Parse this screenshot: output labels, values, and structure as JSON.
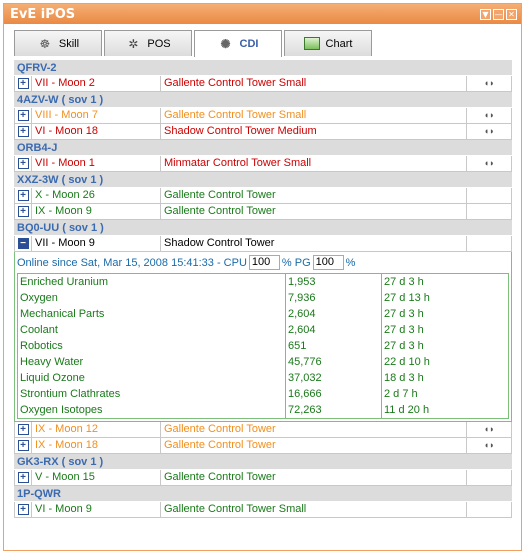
{
  "window": {
    "title": "EvE iPOS",
    "buttons": [
      "▼",
      "—",
      "✕"
    ]
  },
  "tabs": [
    {
      "label": "Skill",
      "icon": "skill-icon",
      "active": false
    },
    {
      "label": "POS",
      "icon": "pos-icon",
      "active": false
    },
    {
      "label": "CDI",
      "icon": "cdi-icon",
      "active": true
    },
    {
      "label": "Chart",
      "icon": "chart-icon",
      "active": false
    }
  ],
  "systems": [
    {
      "name": "QFRV-2",
      "rows": [
        {
          "moon": "VII - Moon 2",
          "tower": "Gallente Control Tower Small",
          "status": "red",
          "icon": true
        }
      ]
    },
    {
      "name": "4AZV-W ( sov 1 )",
      "rows": [
        {
          "moon": "VIII - Moon 7",
          "tower": "Gallente Control Tower Small",
          "status": "orange",
          "icon": true
        },
        {
          "moon": "VI - Moon 18",
          "tower": "Shadow Control Tower Medium",
          "status": "red",
          "icon": true
        }
      ]
    },
    {
      "name": "ORB4-J",
      "rows": [
        {
          "moon": "VII - Moon 1",
          "tower": "Minmatar Control Tower Small",
          "status": "red",
          "icon": true
        }
      ]
    },
    {
      "name": "XXZ-3W ( sov 1 )",
      "rows": [
        {
          "moon": "X - Moon 26",
          "tower": "Gallente Control Tower",
          "status": "green",
          "icon": false
        },
        {
          "moon": "IX - Moon 9",
          "tower": "Gallente Control Tower",
          "status": "green",
          "icon": false
        }
      ]
    },
    {
      "name": "BQ0-UU ( sov 1 )",
      "rows": [
        {
          "moon": "VII - Moon 9",
          "tower": "Shadow Control Tower",
          "status": "black",
          "icon": false,
          "expanded": true,
          "detail": {
            "online_prefix": "Online since Sat, Mar 15, 2008 15:41:33 - CPU",
            "cpu": "100",
            "pg_label": "% PG",
            "pg": "100",
            "pct": "%",
            "fuel": [
              {
                "name": "Enriched Uranium",
                "qty": "1,953",
                "time": "27 d 3 h"
              },
              {
                "name": "Oxygen",
                "qty": "7,936",
                "time": "27 d 13 h"
              },
              {
                "name": "Mechanical Parts",
                "qty": "2,604",
                "time": "27 d 3 h"
              },
              {
                "name": "Coolant",
                "qty": "2,604",
                "time": "27 d 3 h"
              },
              {
                "name": "Robotics",
                "qty": "651",
                "time": "27 d 3 h"
              },
              {
                "name": "Heavy Water",
                "qty": "45,776",
                "time": "22 d 10 h"
              },
              {
                "name": "Liquid Ozone",
                "qty": "37,032",
                "time": "18 d 3 h"
              },
              {
                "name": "Strontium Clathrates",
                "qty": "16,666",
                "time": "2 d 7 h"
              },
              {
                "name": "Oxygen Isotopes",
                "qty": "72,263",
                "time": "11 d 20 h"
              }
            ]
          }
        },
        {
          "moon": "IX - Moon 12",
          "tower": "Gallente Control Tower",
          "status": "orange",
          "icon": true
        },
        {
          "moon": "IX - Moon 18",
          "tower": "Gallente Control Tower",
          "status": "orange",
          "icon": true
        }
      ]
    },
    {
      "name": "GK3-RX ( sov 1 )",
      "rows": [
        {
          "moon": "V - Moon 15",
          "tower": "Gallente Control Tower",
          "status": "green",
          "icon": false
        }
      ]
    },
    {
      "name": "1P-QWR",
      "rows": [
        {
          "moon": "VI - Moon 9",
          "tower": "Gallente Control Tower Small",
          "status": "green",
          "icon": false
        }
      ]
    }
  ]
}
